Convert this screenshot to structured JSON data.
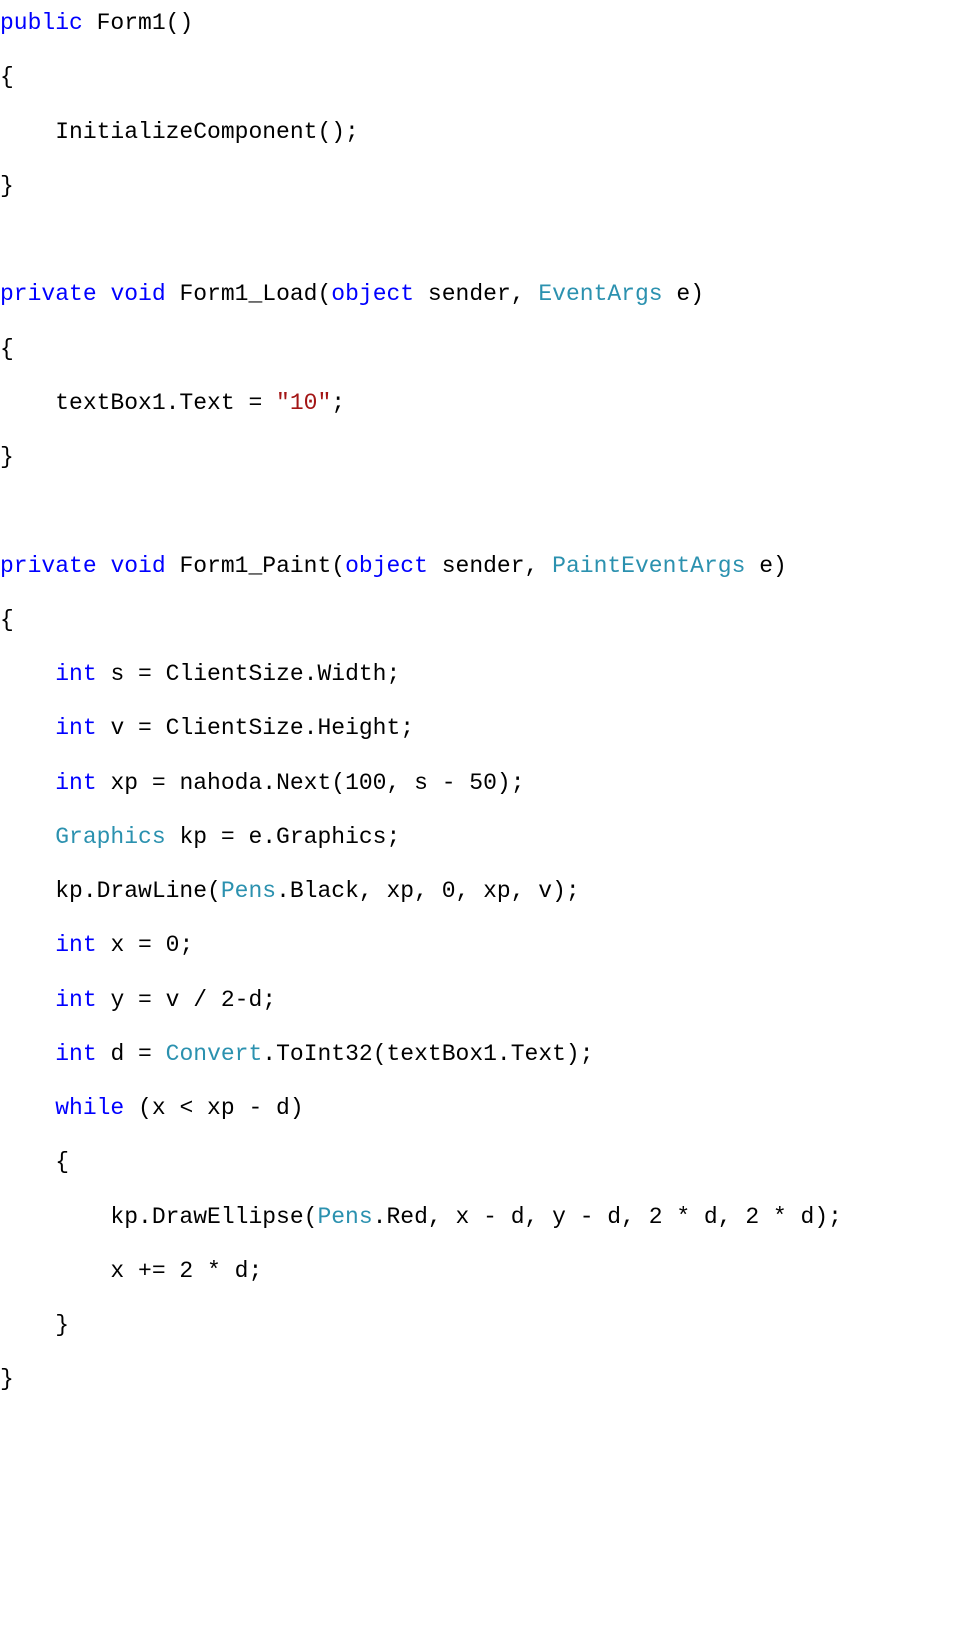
{
  "code_tokens": [
    [
      [
        "kw",
        "public"
      ],
      [
        "txt",
        " Form1()"
      ]
    ],
    [],
    [
      [
        "txt",
        "{"
      ]
    ],
    [],
    [
      [
        "txt",
        "    InitializeComponent();"
      ]
    ],
    [],
    [
      [
        "txt",
        "}"
      ]
    ],
    [],
    [],
    [],
    [
      [
        "kw",
        "private"
      ],
      [
        "txt",
        " "
      ],
      [
        "kw",
        "void"
      ],
      [
        "txt",
        " Form1_Load("
      ],
      [
        "kw",
        "object"
      ],
      [
        "txt",
        " sender, "
      ],
      [
        "typ",
        "EventArgs"
      ],
      [
        "txt",
        " e)"
      ]
    ],
    [],
    [
      [
        "txt",
        "{"
      ]
    ],
    [],
    [
      [
        "txt",
        "    textBox1.Text = "
      ],
      [
        "str",
        "\"10\""
      ],
      [
        "txt",
        ";"
      ]
    ],
    [],
    [
      [
        "txt",
        "}"
      ]
    ],
    [],
    [],
    [],
    [
      [
        "kw",
        "private"
      ],
      [
        "txt",
        " "
      ],
      [
        "kw",
        "void"
      ],
      [
        "txt",
        " Form1_Paint("
      ],
      [
        "kw",
        "object"
      ],
      [
        "txt",
        " sender, "
      ],
      [
        "typ",
        "PaintEventArgs"
      ],
      [
        "txt",
        " e)"
      ]
    ],
    [],
    [
      [
        "txt",
        "{"
      ]
    ],
    [],
    [
      [
        "txt",
        "    "
      ],
      [
        "kw",
        "int"
      ],
      [
        "txt",
        " s = ClientSize.Width;"
      ]
    ],
    [],
    [
      [
        "txt",
        "    "
      ],
      [
        "kw",
        "int"
      ],
      [
        "txt",
        " v = ClientSize.Height;"
      ]
    ],
    [],
    [
      [
        "txt",
        "    "
      ],
      [
        "kw",
        "int"
      ],
      [
        "txt",
        " xp = nahoda.Next(100, s - 50);"
      ]
    ],
    [],
    [
      [
        "txt",
        "    "
      ],
      [
        "typ",
        "Graphics"
      ],
      [
        "txt",
        " kp = e.Graphics;"
      ]
    ],
    [],
    [
      [
        "txt",
        "    kp.DrawLine("
      ],
      [
        "typ",
        "Pens"
      ],
      [
        "txt",
        ".Black, xp, 0, xp, v);"
      ]
    ],
    [],
    [
      [
        "txt",
        "    "
      ],
      [
        "kw",
        "int"
      ],
      [
        "txt",
        " x = 0;"
      ]
    ],
    [],
    [
      [
        "txt",
        "    "
      ],
      [
        "kw",
        "int"
      ],
      [
        "txt",
        " y = v / 2-d;"
      ]
    ],
    [],
    [
      [
        "txt",
        "    "
      ],
      [
        "kw",
        "int"
      ],
      [
        "txt",
        " d = "
      ],
      [
        "typ",
        "Convert"
      ],
      [
        "txt",
        ".ToInt32(textBox1.Text);"
      ]
    ],
    [],
    [
      [
        "txt",
        "    "
      ],
      [
        "kw",
        "while"
      ],
      [
        "txt",
        " (x < xp - d)"
      ]
    ],
    [],
    [
      [
        "txt",
        "    {"
      ]
    ],
    [],
    [
      [
        "txt",
        "        kp.DrawEllipse("
      ],
      [
        "typ",
        "Pens"
      ],
      [
        "txt",
        ".Red, x - d, y - d, 2 * d, 2 * d);"
      ]
    ],
    [],
    [
      [
        "txt",
        "        x += 2 * d;"
      ]
    ],
    [],
    [
      [
        "txt",
        "    }"
      ]
    ],
    [],
    [
      [
        "txt",
        "}"
      ]
    ]
  ]
}
